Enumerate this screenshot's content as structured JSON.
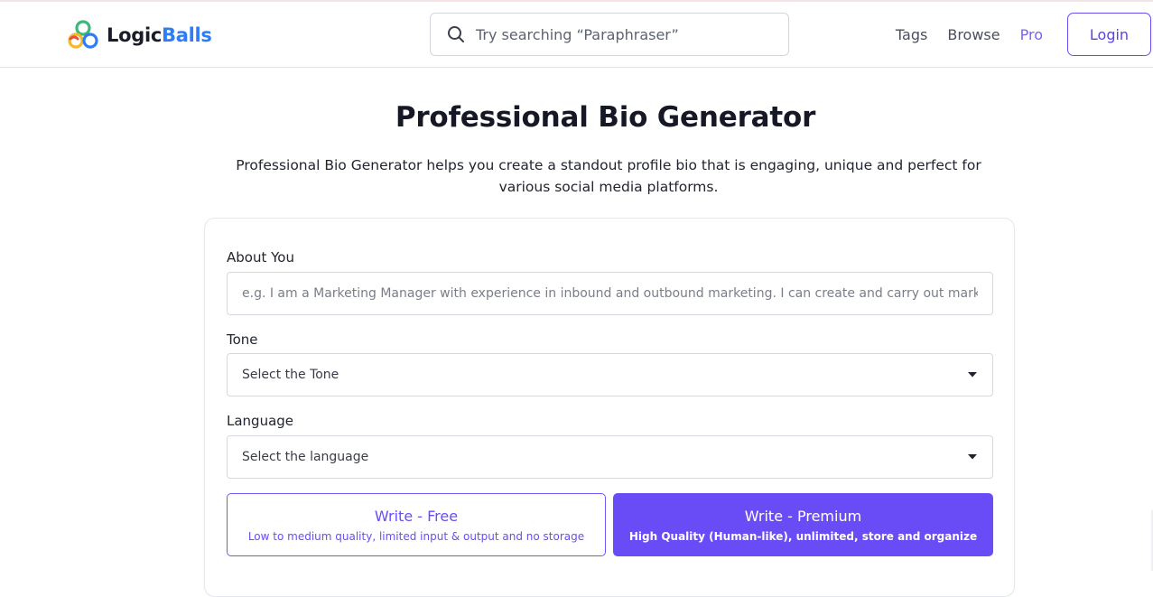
{
  "header": {
    "logo": {
      "text_dark": "Logic",
      "text_blue": "Balls",
      "icon": "logicballs-logo-icon"
    },
    "search": {
      "placeholder": "Try searching “Paraphraser”",
      "icon": "search-icon"
    },
    "nav": {
      "tags": "Tags",
      "browse": "Browse",
      "pro": "Pro",
      "login": "Login"
    }
  },
  "main": {
    "title": "Professional Bio Generator",
    "description": "Professional Bio Generator helps you create a standout profile bio that is engaging, unique and perfect for various social media platforms."
  },
  "form": {
    "about": {
      "label": "About You",
      "placeholder": "e.g. I am a Marketing Manager with experience in inbound and outbound marketing. I can create and carry out marketing strategies"
    },
    "tone": {
      "label": "Tone",
      "selected": "Select the Tone",
      "icon": "caret-down-icon"
    },
    "language": {
      "label": "Language",
      "selected": "Select the language",
      "icon": "caret-down-icon"
    },
    "write_free": {
      "title": "Write - Free",
      "subtitle": "Low to medium quality, limited input & output and no storage"
    },
    "write_premium": {
      "title": "Write - Premium",
      "subtitle": "High Quality (Human-like), unlimited, store and organize"
    }
  },
  "colors": {
    "accent": "#6a4cf6",
    "logo_blue": "#2f7cf6",
    "pro_link": "#7b61f8"
  }
}
